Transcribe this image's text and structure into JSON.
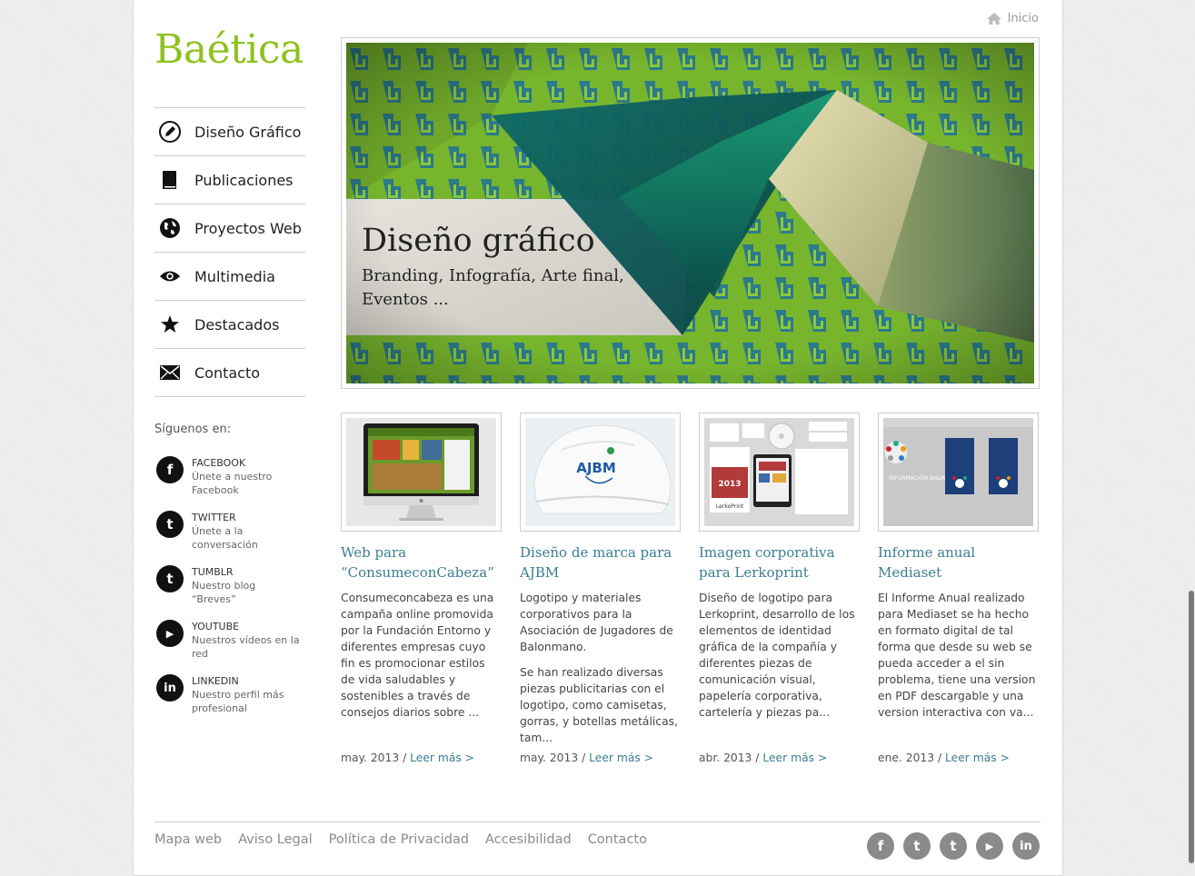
{
  "brand": {
    "logo": "Baética",
    "accent": "#8dc21f",
    "link_color": "#3b7e92"
  },
  "topbar": {
    "home_label": "Inicio"
  },
  "nav": {
    "items": [
      {
        "label": "Diseño Gráfico",
        "icon": "pencil-icon"
      },
      {
        "label": "Publicaciones",
        "icon": "book-icon"
      },
      {
        "label": "Proyectos Web",
        "icon": "globe-icon"
      },
      {
        "label": "Multimedia",
        "icon": "eye-icon"
      },
      {
        "label": "Destacados",
        "icon": "star-icon"
      },
      {
        "label": "Contacto",
        "icon": "envelope-icon"
      }
    ]
  },
  "follow": {
    "title": "Síguenos en:",
    "items": [
      {
        "name": "FACEBOOK",
        "line1": "Únete a nuestro",
        "line2": "Facebook",
        "icon": "facebook-icon",
        "glyph": "f"
      },
      {
        "name": "TWITTER",
        "line1": "Únete a la",
        "line2": "conversación",
        "icon": "twitter-icon",
        "glyph": "t"
      },
      {
        "name": "TUMBLR",
        "line1": "Nuestro blog",
        "line2": "“Breves”",
        "icon": "tumblr-icon",
        "glyph": "t"
      },
      {
        "name": "YOUTUBE",
        "line1": "Nuestros vídeos en la",
        "line2": "red",
        "icon": "youtube-icon",
        "glyph": "▶"
      },
      {
        "name": "LINKEDIN",
        "line1": "Nuestro perfil más",
        "line2": "profesional",
        "icon": "linkedin-icon",
        "glyph": "in"
      }
    ]
  },
  "hero": {
    "title": "Diseño gráfico",
    "subtitle": "Branding, Infografía, Arte final, Eventos ..."
  },
  "cards": [
    {
      "title": "Web para “ConsumeconCabeza”",
      "body": [
        "Consumeconcabeza es una campaña online promovida por la Fundación Entorno y diferentes empresas cuyo fin es promocionar estilos de vida saludables y sostenibles a través de consejos diarios sobre ..."
      ],
      "date": "may. 2013",
      "more": "Leer más >"
    },
    {
      "title": "Diseño de marca para AJBM",
      "body": [
        "Logotipo y materiales corporativos para la Asociación de Jugadores de Balonmano.",
        "Se han realizado diversas piezas publicitarias con el logotipo, como camisetas, gorras, y botellas metálicas, tam..."
      ],
      "date": "may. 2013",
      "more": "Leer más >"
    },
    {
      "title": "Imagen corporativa para Lerkoprint",
      "body": [
        "Diseño de logotipo para Lerkoprint, desarrollo de los elementos de identidad gráfica de la compañía y diferentes piezas de comunicación visual, papelería corporativa, cartelería y piezas pa..."
      ],
      "date": "abr. 2013",
      "more": "Leer más >"
    },
    {
      "title": "Informe anual Mediaset",
      "body": [
        "El Informe Anual realizado para Mediaset se ha hecho en formato digital de tal forma que desde su web se pueda acceder a el sin problema, tiene una version en PDF descargable y una version interactiva con va..."
      ],
      "date": "ene. 2013",
      "more": "Leer más >"
    }
  ],
  "thumb_text": {
    "ajbm": "AJBM",
    "lerko": "LerkoPrint",
    "lerko_year": "2013",
    "mediaset": "INFORMACIÓN ANUAL 2011"
  },
  "footer": {
    "links": [
      "Mapa web",
      "Aviso Legal",
      "Política de Privacidad",
      "Accesibilidad",
      "Contacto"
    ],
    "social": [
      {
        "icon": "facebook-icon",
        "glyph": "f"
      },
      {
        "icon": "twitter-icon",
        "glyph": "t"
      },
      {
        "icon": "tumblr-icon",
        "glyph": "t"
      },
      {
        "icon": "youtube-icon",
        "glyph": "▶"
      },
      {
        "icon": "linkedin-icon",
        "glyph": "in"
      }
    ]
  }
}
